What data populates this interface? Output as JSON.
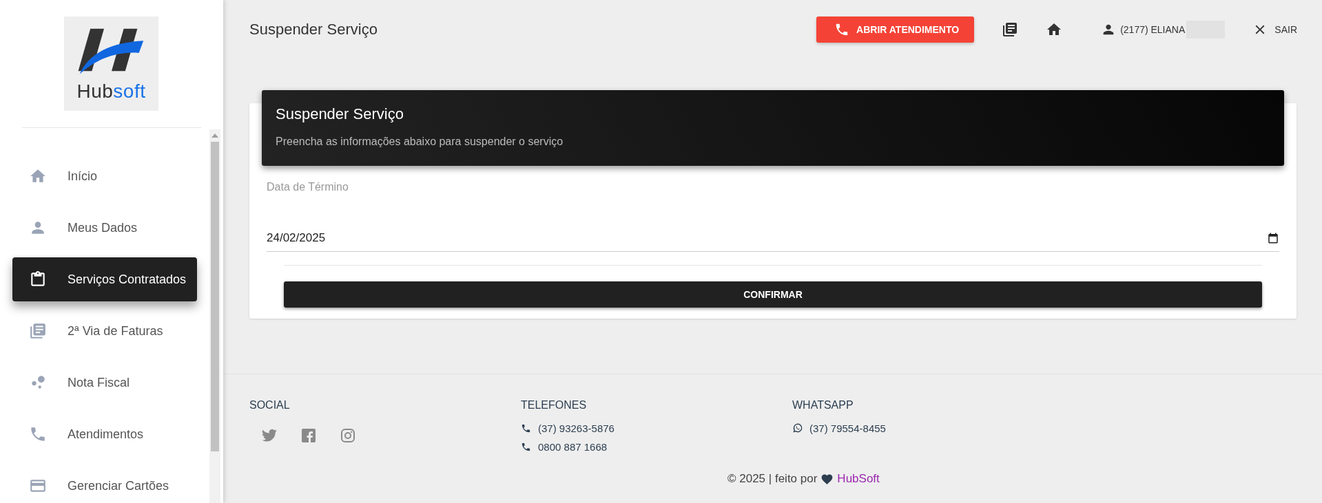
{
  "logo": {
    "parts": [
      "Hub",
      "soft"
    ]
  },
  "sidebar": {
    "items": [
      {
        "label": "Início",
        "selected": false
      },
      {
        "label": "Meus Dados",
        "selected": false
      },
      {
        "label": "Serviços Contratados",
        "selected": true
      },
      {
        "label": "2ª Via de Faturas",
        "selected": false
      },
      {
        "label": "Nota Fiscal",
        "selected": false
      },
      {
        "label": "Atendimentos",
        "selected": false
      },
      {
        "label": "Gerenciar Cartões",
        "selected": false
      }
    ]
  },
  "header": {
    "title": "Suspender Serviço",
    "call_button": "ABRIR ATENDIMENTO",
    "user": "(2177) ELIANA",
    "logout": "SAIR"
  },
  "card": {
    "title": "Suspender Serviço",
    "subtitle": "Preencha as informações abaixo para suspender o serviço",
    "field_label": "Data de Término",
    "field_value": "24/02/2025",
    "button": "CONFIRMAR"
  },
  "footer": {
    "social_heading": "SOCIAL",
    "phones_heading": "TELEFONES",
    "phones": [
      "(37) 93263-5876",
      "0800 887 1668"
    ],
    "whatsapp_heading": "WHATSAPP",
    "whatsapp": [
      "(37) 79554-8455"
    ],
    "copyright": "© 2025 | feito por",
    "credit_link": "HubSoft"
  }
}
